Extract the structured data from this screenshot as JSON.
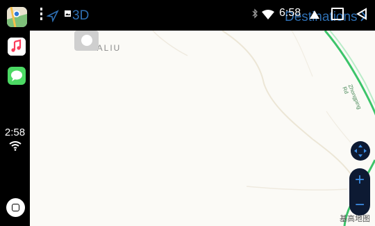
{
  "dock": {
    "apps": [
      {
        "name": "Maps"
      },
      {
        "name": "Music"
      },
      {
        "name": "Messages"
      }
    ],
    "time": "2:58"
  },
  "topbar": {
    "view_mode": "3D",
    "clock": "6:58",
    "destinations_label": "Destinations"
  },
  "map": {
    "area_label": "NALIU",
    "road_label": "Zhongping Rd",
    "watermark": "基高地图"
  },
  "controls": {
    "zoom_in": "+",
    "zoom_out": "−"
  },
  "colors": {
    "accent": "#2e6fb3",
    "control_bg": "#0d1a33",
    "road_green": "#3cc46a"
  }
}
